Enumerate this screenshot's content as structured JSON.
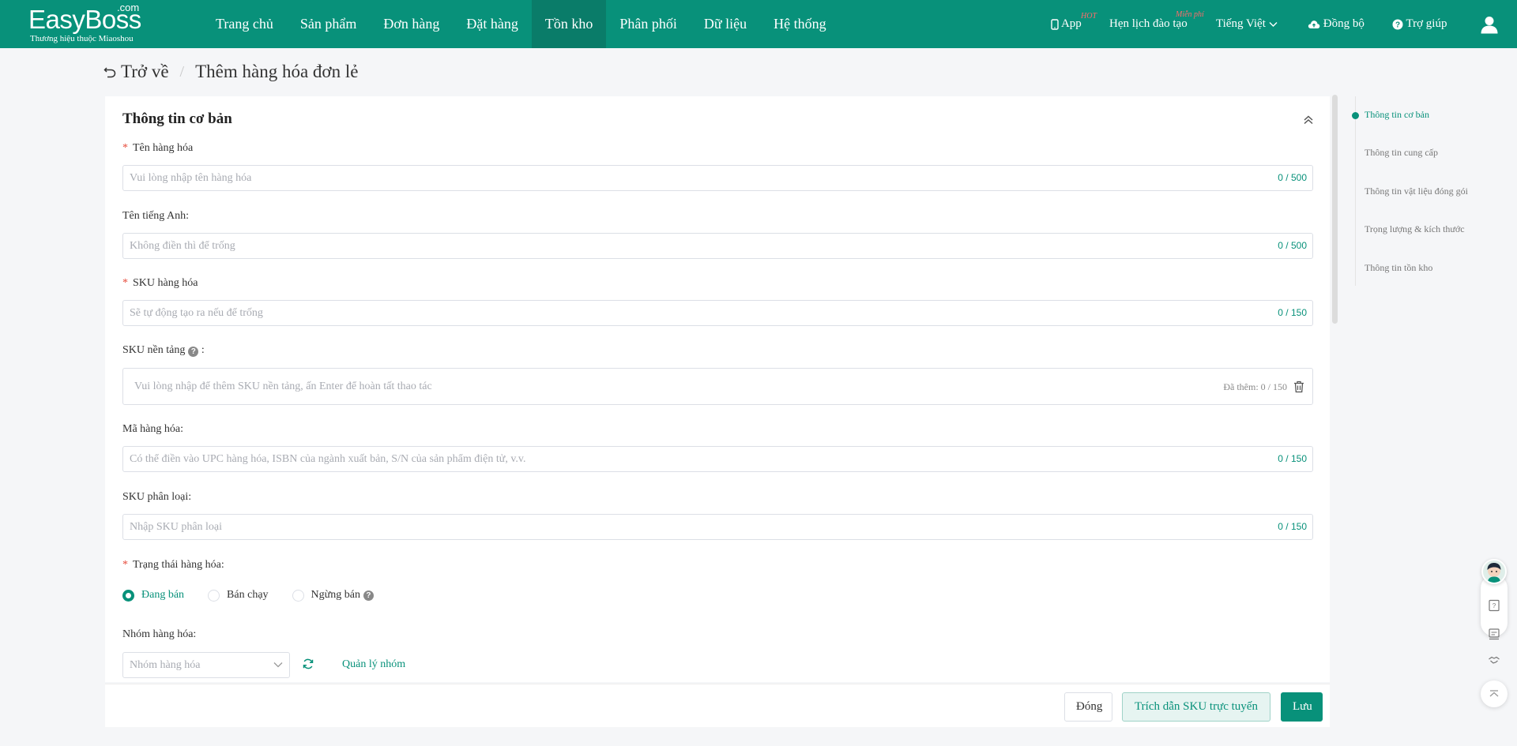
{
  "brand": {
    "name": "EasyBoss",
    "com": ".com",
    "tagline": "Thương hiệu thuộc Miaoshou"
  },
  "nav": {
    "items": [
      {
        "label": "Trang chủ"
      },
      {
        "label": "Sản phẩm"
      },
      {
        "label": "Đơn hàng"
      },
      {
        "label": "Đặt hàng"
      },
      {
        "label": "Tồn kho"
      },
      {
        "label": "Phân phối"
      },
      {
        "label": "Dữ liệu"
      },
      {
        "label": "Hệ thống"
      }
    ],
    "active": "Tồn kho"
  },
  "topRight": {
    "app": "App",
    "app_badge": "HOT",
    "training": "Hẹn lịch đào tạo",
    "training_badge": "Miễn phí",
    "language": "Tiếng Việt",
    "sync": "Đồng bộ",
    "help": "Trợ giúp"
  },
  "breadcrumb": {
    "back": "Trở về",
    "current": "Thêm hàng hóa đơn lẻ"
  },
  "section": {
    "title": "Thông tin cơ bản"
  },
  "fields": {
    "name": {
      "label": "Tên hàng hóa",
      "placeholder": "Vui lòng nhập tên hàng hóa",
      "count": "0 / 500"
    },
    "english": {
      "label": "Tên tiếng Anh:",
      "placeholder": "Không điền thì để trống",
      "count": "0 / 500"
    },
    "sku": {
      "label": "SKU hàng hóa",
      "placeholder": "Sẽ tự động tạo ra nếu để trống",
      "count": "0 / 150"
    },
    "platform_sku": {
      "label": "SKU nền tảng",
      "suffix": ":",
      "placeholder": "Vui lòng nhập để thêm SKU nền tảng, ấn Enter để hoàn tất thao tác",
      "count": "Đã thêm: 0 / 150"
    },
    "code": {
      "label": "Mã hàng hóa:",
      "placeholder": "Có thể điền vào UPC hàng hóa, ISBN của ngành xuất bản, S/N của sản phẩm điện tử, v.v.",
      "count": "0 / 150"
    },
    "variant_sku": {
      "label": "SKU phân loại:",
      "placeholder": "Nhập SKU phân loại",
      "count": "0 / 150"
    },
    "status": {
      "label": "Trạng thái hàng hóa:",
      "options": [
        {
          "label": "Đang bán"
        },
        {
          "label": "Bán chạy"
        },
        {
          "label": "Ngừng bán"
        }
      ],
      "selected": "Đang bán"
    },
    "group": {
      "label": "Nhóm hàng hóa:",
      "placeholder": "Nhóm hàng hóa",
      "manage": "Quản lý nhóm"
    }
  },
  "footer": {
    "close": "Đóng",
    "quote": "Trích dẫn SKU trực tuyến",
    "save": "Lưu"
  },
  "anchors": {
    "items": [
      {
        "label": "Thông tin cơ bản"
      },
      {
        "label": "Thông tin cung cấp"
      },
      {
        "label": "Thông tin vật liệu đóng gói"
      },
      {
        "label": "Trọng lượng & kích thước"
      },
      {
        "label": "Thông tin tồn kho"
      }
    ],
    "active": "Thông tin cơ bản"
  },
  "colors": {
    "primary": "#08917a",
    "nav_active": "#0a7c69",
    "required": "#e74c3c"
  }
}
